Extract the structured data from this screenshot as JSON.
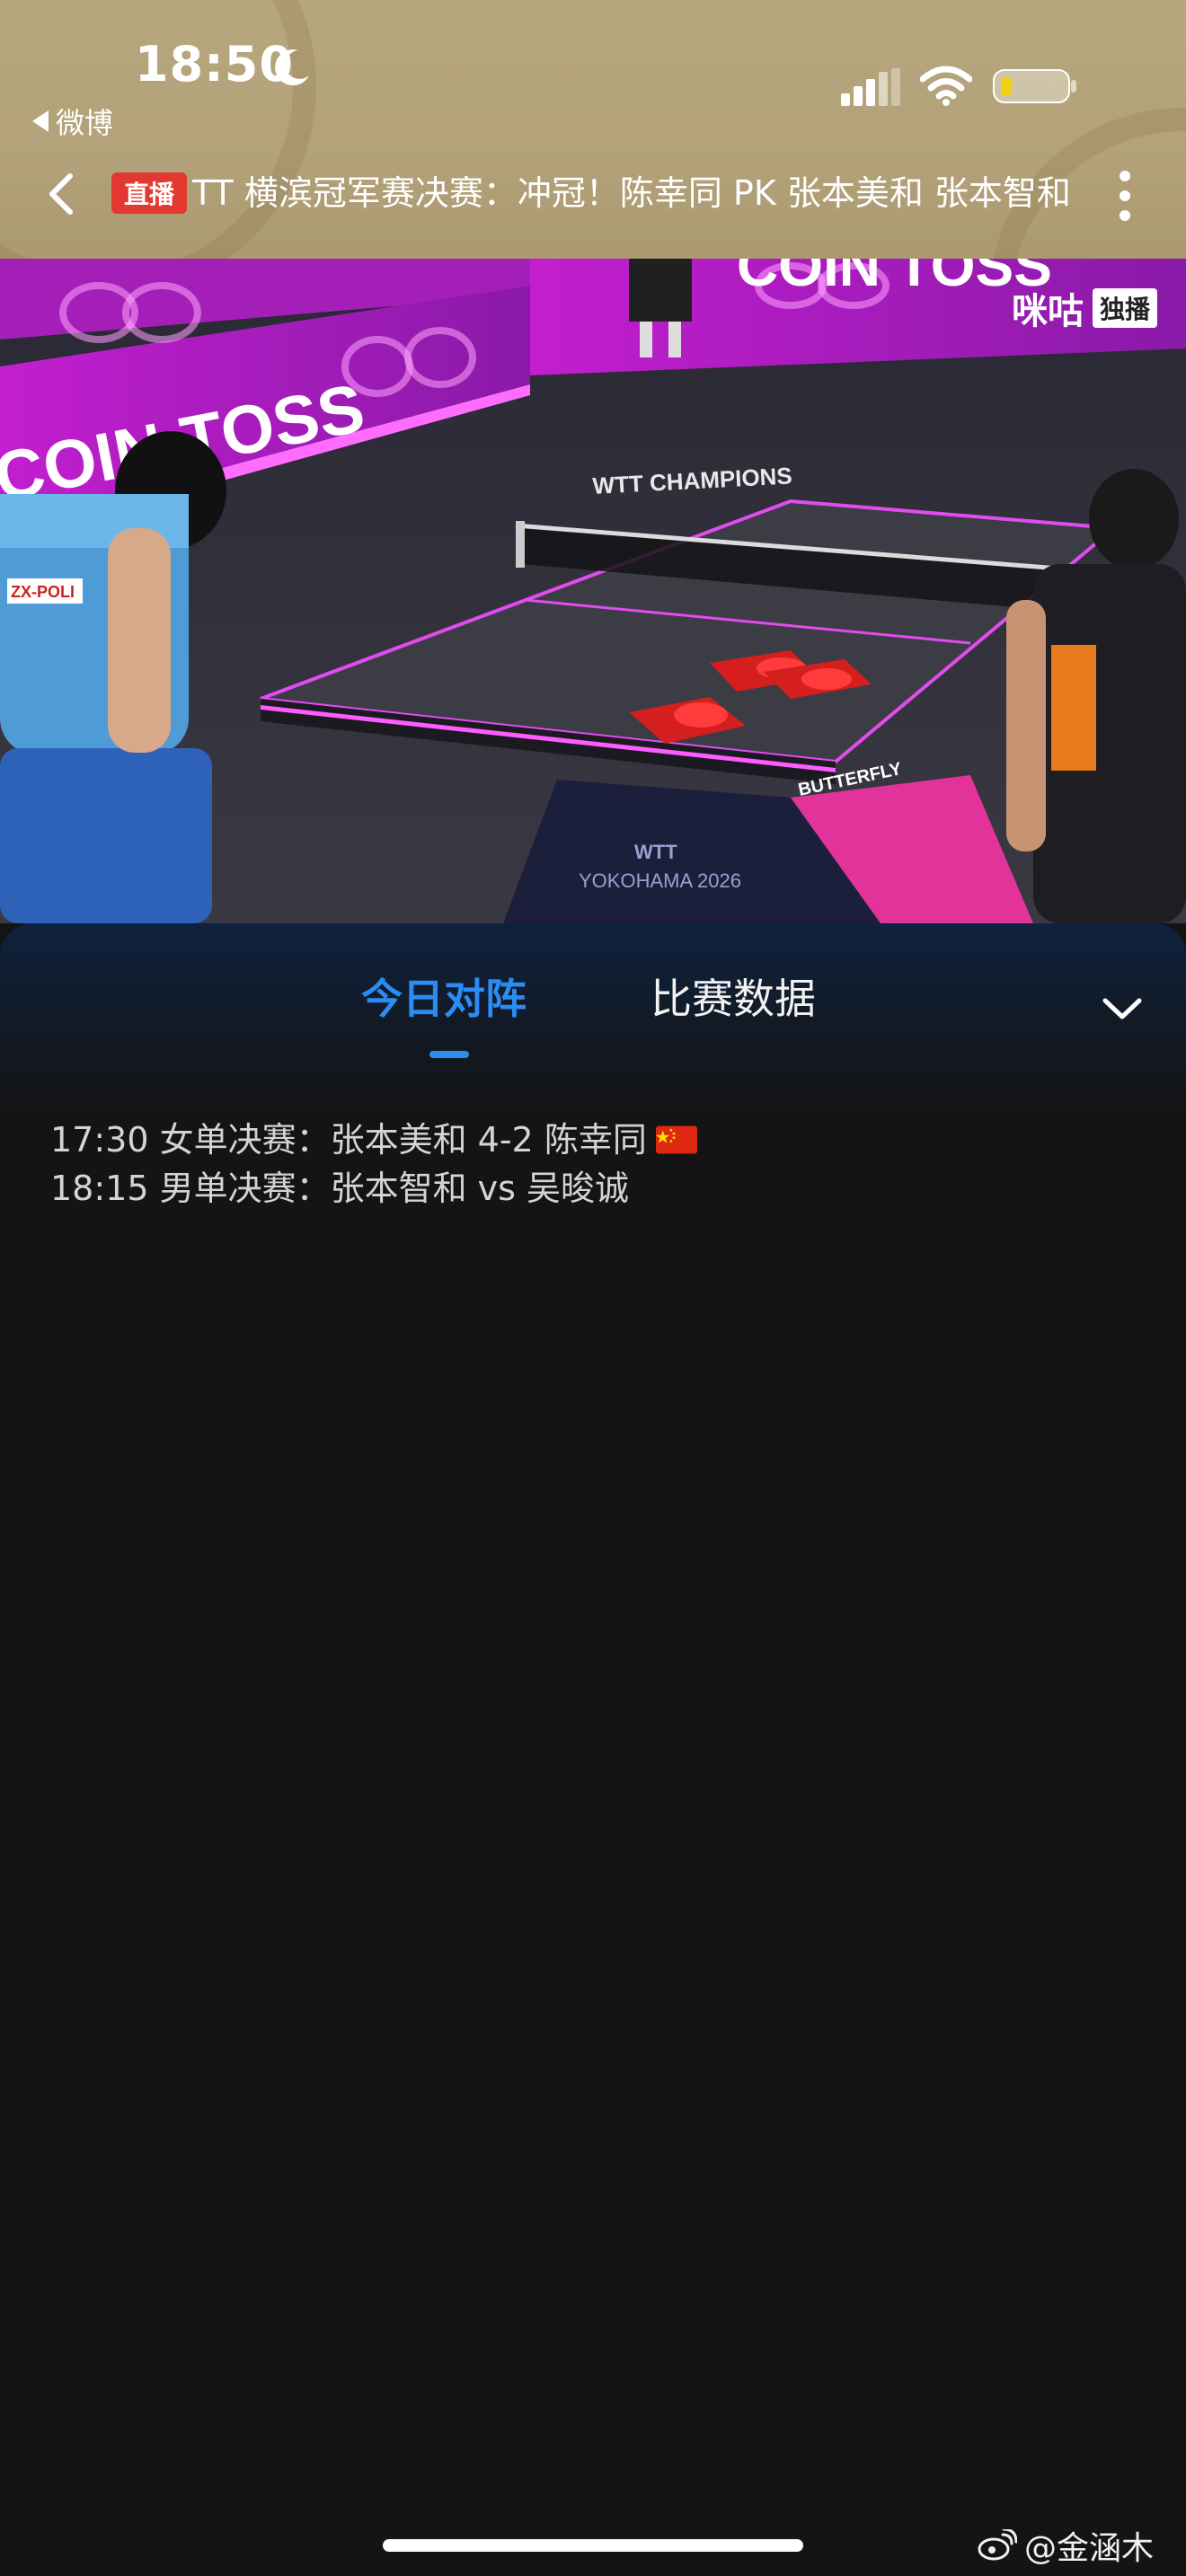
{
  "status_bar": {
    "time": "18:50",
    "back_app_label": "微博",
    "icons": [
      "moon-icon",
      "signal-icon",
      "wifi-icon",
      "battery-icon"
    ],
    "battery_color": "#f2d20f"
  },
  "title_bar": {
    "live_badge": "直播",
    "title": "TT 横滨冠军赛决赛：冲冠！陈幸同 PK 张本美和 张本智和 vs 吴晙诚"
  },
  "video": {
    "watermark": "咪咕",
    "watermark_badge": "独播",
    "banner_text_1": "COIN TOSS",
    "banner_text_2": "COIN TOSS",
    "floor_logo": "WTT CHAMPIONS",
    "table_brand": "BUTTERFLY",
    "event_line1": "WTT",
    "event_line2": "YOKOHAMA 2026",
    "jersey_sponsor": "ZX-POLI"
  },
  "panel": {
    "tabs": [
      {
        "label": "今日对阵",
        "active": true
      },
      {
        "label": "比赛数据",
        "active": false
      }
    ],
    "accent_color": "#2b8cf2",
    "schedule": [
      {
        "text": "17:30 女单决赛：张本美和 4-2 陈幸同",
        "flag": "china-flag-icon"
      },
      {
        "text": "18:15 男单决赛：张本智和 vs 吴晙诚",
        "flag": null
      }
    ]
  },
  "footer": {
    "weibo_watermark": "@金涵木"
  }
}
